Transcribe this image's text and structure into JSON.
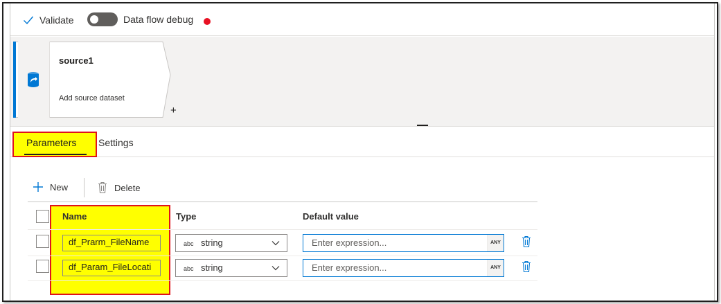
{
  "toolbar": {
    "validate_label": "Validate",
    "debug_label": "Data flow debug",
    "debug_toggle_on": false,
    "debug_status_color": "#e81123"
  },
  "canvas": {
    "node": {
      "title": "source1",
      "subtitle": "Add source dataset",
      "icon": "source-dataset-icon",
      "accent_color": "#0078d4"
    },
    "add_label": "+"
  },
  "tabs": [
    {
      "label": "Parameters",
      "active": true
    },
    {
      "label": "Settings",
      "active": false
    }
  ],
  "commands": {
    "new_label": "New",
    "delete_label": "Delete"
  },
  "grid": {
    "headers": [
      "Name",
      "Type",
      "Default value"
    ],
    "rows": [
      {
        "name": "df_Prarm_FileName",
        "type_badge": "abc",
        "type": "string",
        "default_placeholder": "Enter expression...",
        "any_badge": "ANY"
      },
      {
        "name": "df_Param_FileLocati",
        "type_badge": "abc",
        "type": "string",
        "default_placeholder": "Enter expression...",
        "any_badge": "ANY"
      }
    ]
  },
  "highlight_color": "#ffff00",
  "annotation_border_color": "#e0121b"
}
